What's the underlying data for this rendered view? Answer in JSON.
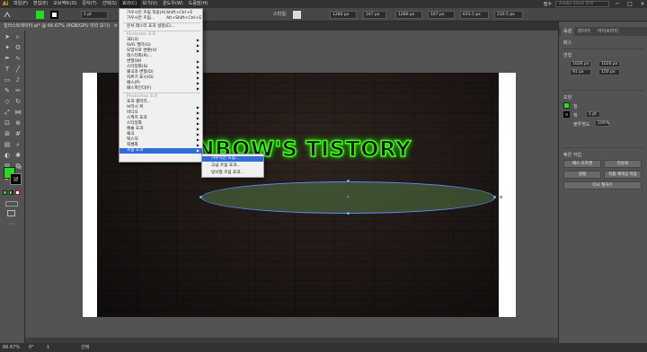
{
  "app": {
    "logo": "Ai"
  },
  "menubar": {
    "items": [
      "파일(F)",
      "편집(E)",
      "오브젝트(O)",
      "문자(T)",
      "선택(S)",
      "효과(C)",
      "보기(V)",
      "윈도우(W)",
      "도움말(H)"
    ],
    "workspace": "필수",
    "stock_search": "Adobe Stock 검색",
    "window_buttons": [
      "─",
      "□",
      "✕"
    ]
  },
  "controlbar": {
    "stroke_width": "1 pt",
    "style_label": "스타일:",
    "w_value": "1280 px",
    "h_value": "167 px",
    "x_value": "1280 px",
    "y_value": "167 px",
    "x2_value": "633.5 px",
    "y2_value": "210.5 px"
  },
  "document": {
    "tab_label": "일러스트레이터.ai* @ 66.67% (RGB/GPU 미리 보기)",
    "close_glyph": "×"
  },
  "toolbar": {
    "tools": [
      "select-tool",
      "direct-select-tool",
      "magic-wand-tool",
      "lasso-tool",
      "pen-tool",
      "curvature-tool",
      "type-tool",
      "line-tool",
      "rectangle-tool",
      "paintbrush-tool",
      "shaper-tool",
      "pencil-tool",
      "eraser-tool",
      "rotate-tool",
      "scale-tool",
      "width-tool",
      "free-transform-tool",
      "shape-builder-tool",
      "perspective-tool",
      "mesh-tool",
      "gradient-tool",
      "eyedropper-tool",
      "blend-tool",
      "symbol-sprayer-tool",
      "column-graph-tool",
      "artboard-tool",
      "slice-tool",
      "hand-tool",
      "zoom-tool"
    ],
    "fill_color": "#1fe01f",
    "stroke_color": "#000000"
  },
  "canvas": {
    "neon_text": "RAINBOW'S TISTORY",
    "neon_color": "#3cff1a"
  },
  "effect_menu": {
    "items": [
      {
        "label": "가우시안 흐림 적용(A)",
        "shortcut": "Shift+Ctrl+E",
        "type": "item"
      },
      {
        "label": "가우시안 흐림...",
        "shortcut": "Alt+Shift+Ctrl+E",
        "type": "item"
      },
      {
        "type": "sep"
      },
      {
        "label": "문서 래스터 효과 설정(E)...",
        "type": "item"
      },
      {
        "type": "sep"
      },
      {
        "label": "Illustrator 효과",
        "type": "section"
      },
      {
        "label": "3D(3)",
        "type": "sub"
      },
      {
        "label": "SVG 필터(G)",
        "type": "sub"
      },
      {
        "label": "모양으로 변환(V)",
        "type": "sub"
      },
      {
        "label": "래스터화(R)...",
        "type": "item"
      },
      {
        "label": "변형(W)",
        "type": "sub"
      },
      {
        "label": "스타일화(S)",
        "type": "sub"
      },
      {
        "label": "왜곡과 변형(D)",
        "type": "sub"
      },
      {
        "label": "자르기 표시(O)",
        "type": "sub"
      },
      {
        "label": "패스(P)",
        "type": "sub"
      },
      {
        "label": "패스파인더(F)",
        "type": "sub"
      },
      {
        "type": "sep"
      },
      {
        "label": "Photoshop 효과",
        "type": "section"
      },
      {
        "label": "효과 갤러리...",
        "type": "item"
      },
      {
        "label": "브러시 획",
        "type": "sub"
      },
      {
        "label": "비디오",
        "type": "sub"
      },
      {
        "label": "스케치 효과",
        "type": "sub"
      },
      {
        "label": "스타일화",
        "type": "sub"
      },
      {
        "label": "예술 효과",
        "type": "sub"
      },
      {
        "label": "왜곡",
        "type": "sub"
      },
      {
        "label": "텍스처",
        "type": "sub"
      },
      {
        "label": "픽셀화",
        "type": "sub"
      },
      {
        "label": "흐림 효과",
        "type": "sub",
        "highlight": true
      }
    ]
  },
  "blur_submenu": {
    "items": [
      "가우시안 흐림...",
      "고급 흐림 효과...",
      "방사형 흐림 효과..."
    ]
  },
  "right_panel": {
    "tabs": [
      "속성",
      "레이어",
      "라이브러리"
    ],
    "section_path": "패스",
    "transform": "변형",
    "w": "1026 px",
    "h": "91 px",
    "x": "1026 px",
    "y": "150 px",
    "appearance": "모양",
    "fill_label": "칠",
    "stroke_label": "획",
    "stroke_value": "1 pt",
    "opacity_label": "불투명도",
    "opacity_value": "100%",
    "quick_actions": "빠른 작업",
    "btn_offset": "패스 오프셋",
    "btn_simplify": "단순화",
    "btn_arrange": "정렬",
    "btn_recolor": "작품 재색상 적용",
    "btn_align": "다시 칠하기"
  },
  "status": {
    "zoom": "66.67%",
    "rotation": "0°",
    "artboard": "1",
    "mode": "선택"
  }
}
